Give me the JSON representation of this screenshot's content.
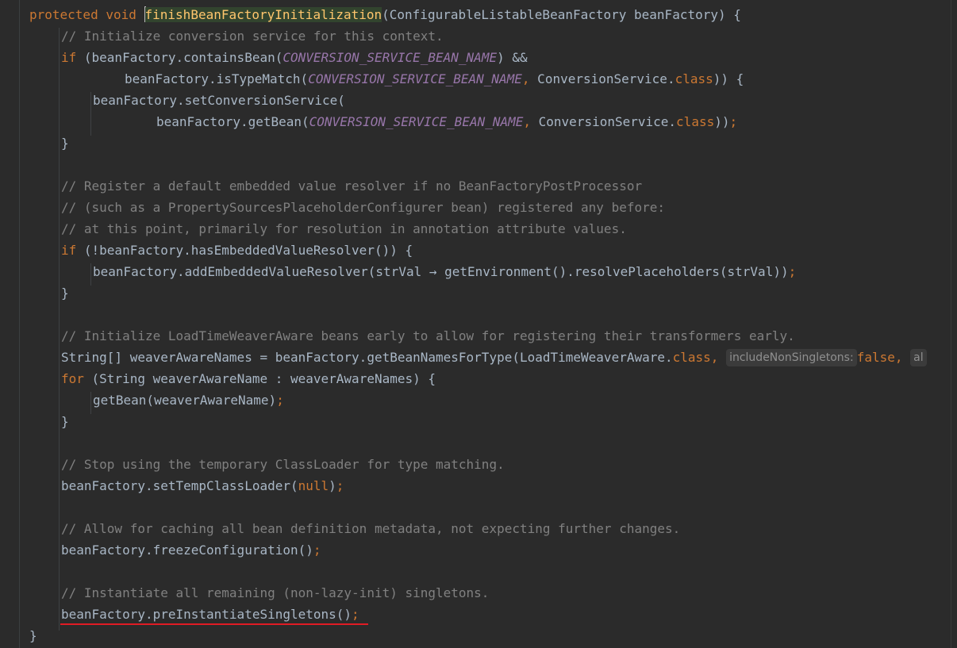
{
  "editor": {
    "language": "Java",
    "colors": {
      "background": "#2b2b2b",
      "default_text": "#a9b7c6",
      "keyword": "#cc7832",
      "comment": "#808080",
      "constant": "#9876aa",
      "method_declaration": "#ffc66d",
      "underline": "#e01b24"
    },
    "lines": {
      "l1": {
        "kw_protected": "protected",
        "kw_void": "void",
        "method_name": "finishBeanFactoryInitialization",
        "params": "(ConfigurableListableBeanFactory beanFactory) {"
      },
      "l2": {
        "comment": "// Initialize conversion service for this context."
      },
      "l3": {
        "kw_if": "if",
        "text1": " (beanFactory.containsBean(",
        "const": "CONVERSION_SERVICE_BEAN_NAME",
        "text2": ") &&"
      },
      "l4": {
        "text1": "beanFactory.isTypeMatch(",
        "const": "CONVERSION_SERVICE_BEAN_NAME",
        "sep": ",",
        "text2": " ConversionService.",
        "kw_class": "class",
        "text3": ")) {"
      },
      "l5": {
        "text": "beanFactory.setConversionService("
      },
      "l6": {
        "text1": "beanFactory.getBean(",
        "const": "CONVERSION_SERVICE_BEAN_NAME",
        "sep": ",",
        "text2": " ConversionService.",
        "kw_class": "class",
        "text3": "))",
        "semi": ";"
      },
      "l7": {
        "text": "}"
      },
      "l9": {
        "comment": "// Register a default embedded value resolver if no BeanFactoryPostProcessor"
      },
      "l10": {
        "comment": "// (such as a PropertySourcesPlaceholderConfigurer bean) registered any before:"
      },
      "l11": {
        "comment": "// at this point, primarily for resolution in annotation attribute values."
      },
      "l12": {
        "kw_if": "if",
        "text": " (!beanFactory.hasEmbeddedValueResolver()) {"
      },
      "l13": {
        "text": "beanFactory.addEmbeddedValueResolver(strVal → getEnvironment().resolvePlaceholders(strVal))",
        "semi": ";"
      },
      "l14": {
        "text": "}"
      },
      "l16": {
        "comment": "// Initialize LoadTimeWeaverAware beans early to allow for registering their transformers early."
      },
      "l17": {
        "text1": "String[] weaverAwareNames = beanFactory.getBeanNamesForType(LoadTimeWeaverAware.",
        "kw_class": "class",
        "sep1": ",",
        "hint1": "includeNonSingletons:",
        "kw_false": "false",
        "sep2": ",",
        "hint2": "al"
      },
      "l18": {
        "kw_for": "for",
        "text": " (String weaverAwareName : weaverAwareNames) {"
      },
      "l19": {
        "text": "getBean(weaverAwareName)",
        "semi": ";"
      },
      "l20": {
        "text": "}"
      },
      "l22": {
        "comment": "// Stop using the temporary ClassLoader for type matching."
      },
      "l23": {
        "text1": "beanFactory.setTempClassLoader(",
        "kw_null": "null",
        "text2": ")",
        "semi": ";"
      },
      "l25": {
        "comment": "// Allow for caching all bean definition metadata, not expecting further changes."
      },
      "l26": {
        "text": "beanFactory.freezeConfiguration()",
        "semi": ";"
      },
      "l28": {
        "comment": "// Instantiate all remaining (non-lazy-init) singletons."
      },
      "l29": {
        "text": "beanFactory.preInstantiateSingletons()",
        "semi": ";"
      },
      "l30": {
        "text": "}"
      }
    }
  }
}
